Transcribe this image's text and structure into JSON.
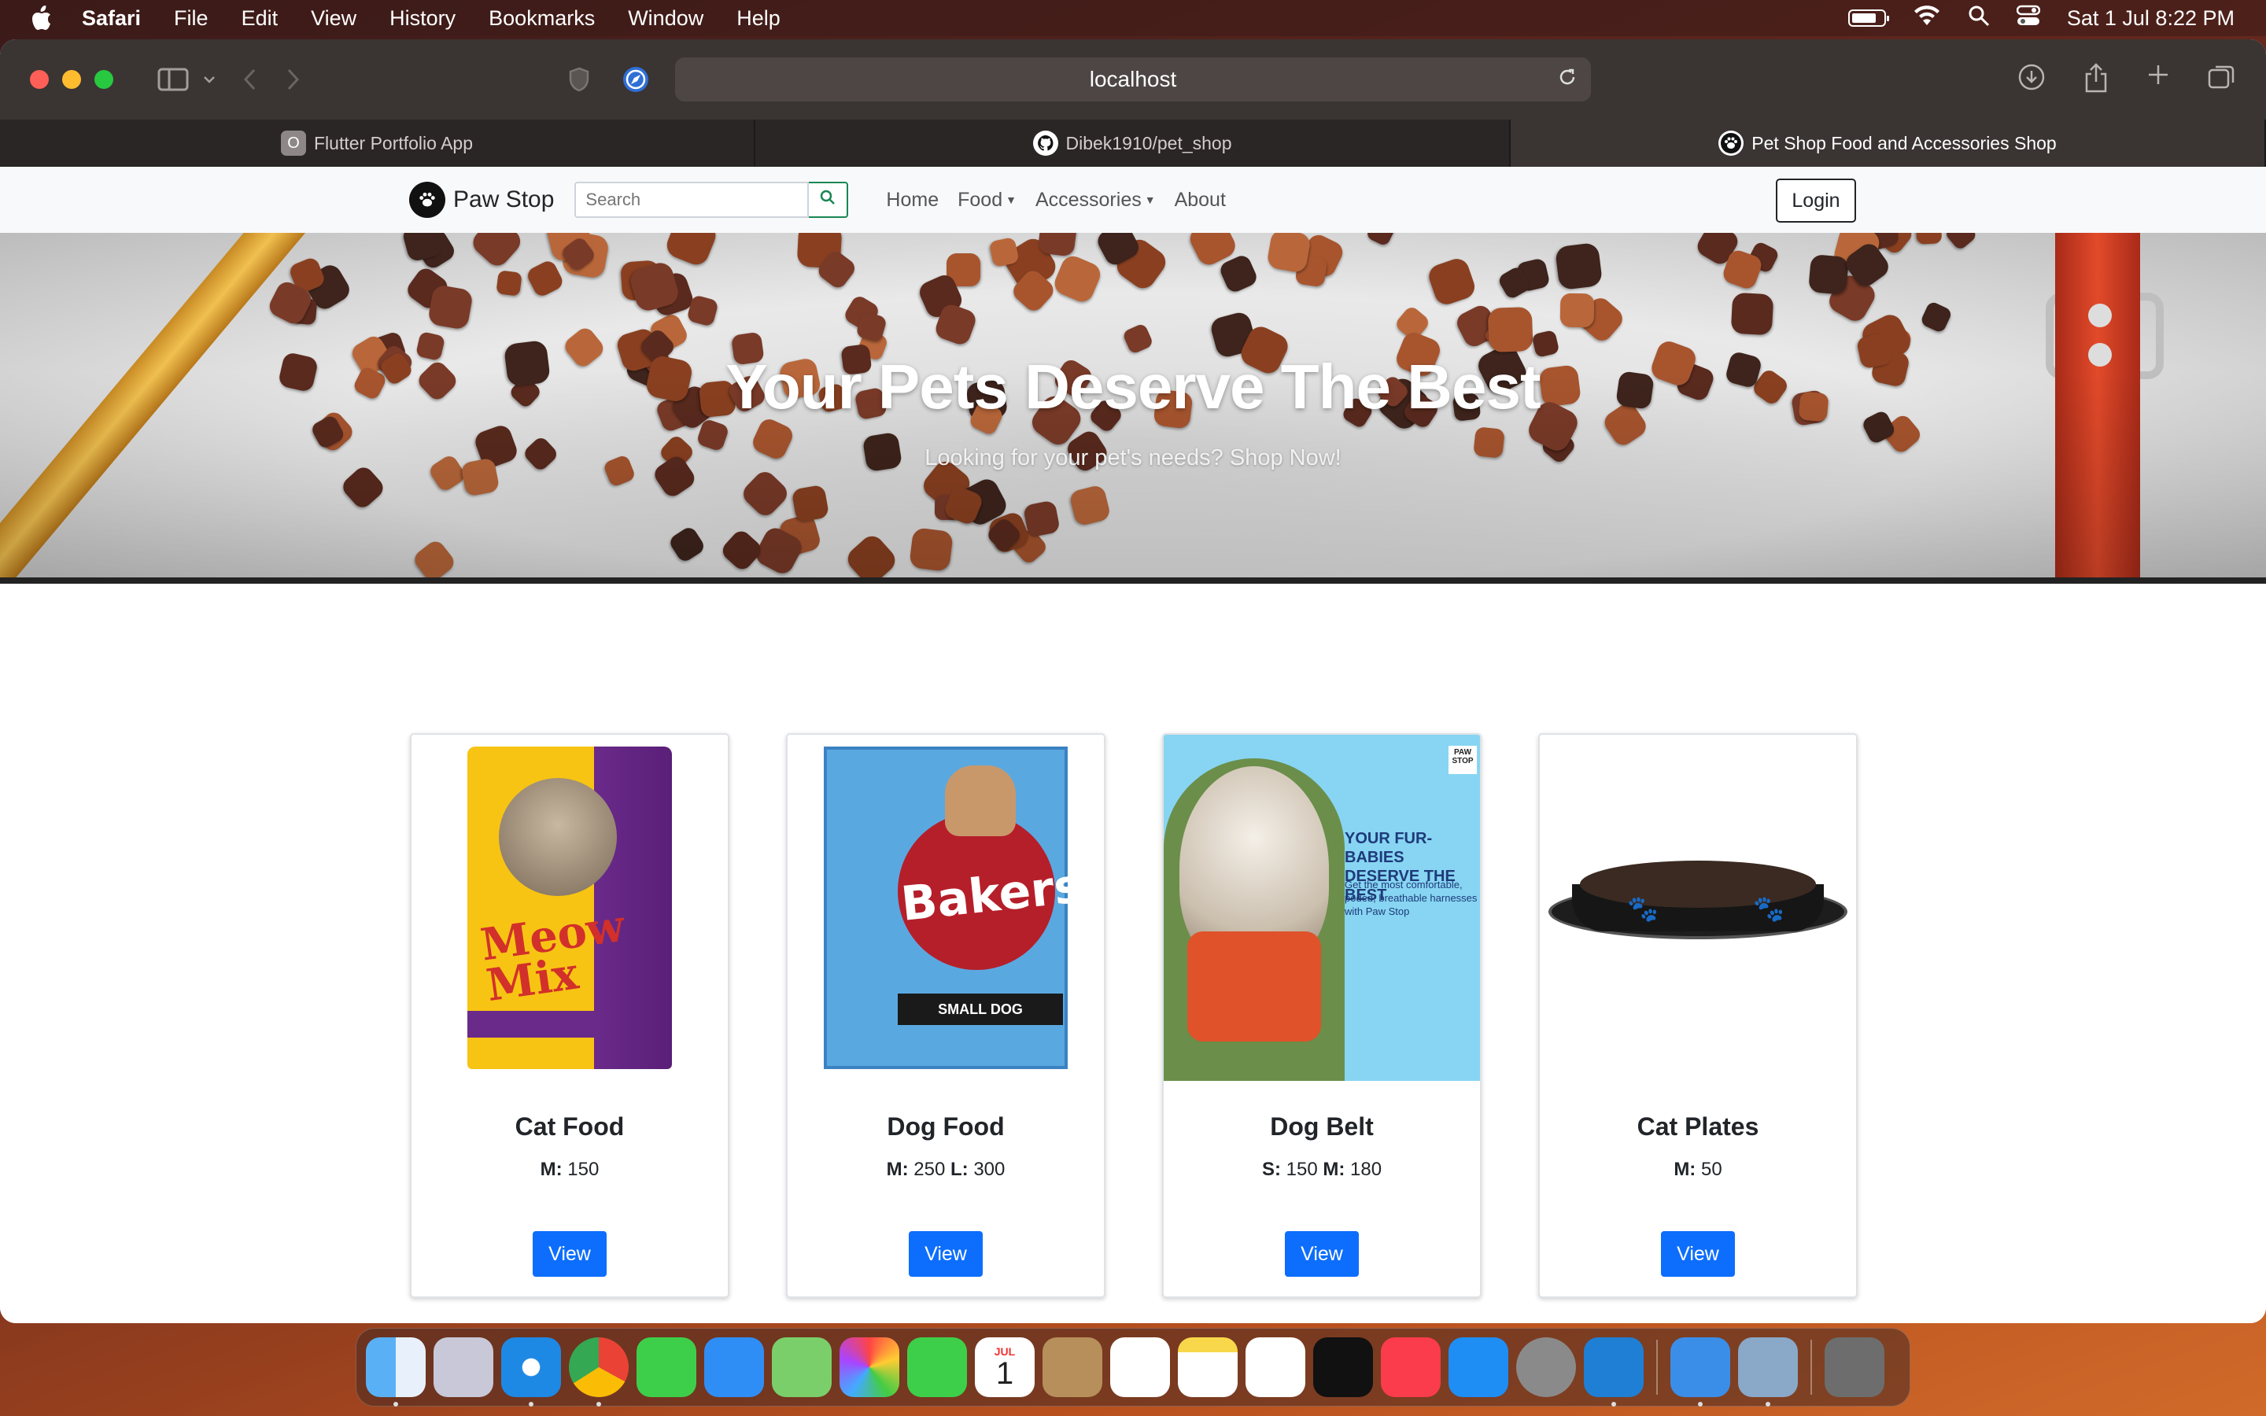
{
  "menubar": {
    "app_name": "Safari",
    "items": [
      "File",
      "Edit",
      "View",
      "History",
      "Bookmarks",
      "Window",
      "Help"
    ],
    "datetime": "Sat 1 Jul  8:22 PM"
  },
  "browser": {
    "url": "localhost",
    "tabs": [
      {
        "label": "Flutter Portfolio App",
        "icon": "flutter-icon",
        "active": false
      },
      {
        "label": "Dibek1910/pet_shop",
        "icon": "github-icon",
        "active": false
      },
      {
        "label": "Pet Shop Food and Accessories Shop",
        "icon": "paw-icon",
        "active": true
      }
    ]
  },
  "nav": {
    "brand": "Paw Stop",
    "search_placeholder": "Search",
    "links": [
      {
        "label": "Home",
        "dropdown": false
      },
      {
        "label": "Food",
        "dropdown": true
      },
      {
        "label": "Accessories",
        "dropdown": true
      },
      {
        "label": "About",
        "dropdown": false
      }
    ],
    "login_label": "Login"
  },
  "hero": {
    "title": "Your Pets Deserve The Best",
    "subtitle": "Looking for your pet's needs? Shop Now!"
  },
  "products": [
    {
      "name": "Cat Food",
      "prices": [
        {
          "size": "M:",
          "value": "150"
        }
      ],
      "button": "View"
    },
    {
      "name": "Dog Food",
      "prices": [
        {
          "size": "M:",
          "value": "250"
        },
        {
          "size": "L:",
          "value": "300"
        }
      ],
      "button": "View"
    },
    {
      "name": "Dog Belt",
      "prices": [
        {
          "size": "S:",
          "value": "150"
        },
        {
          "size": "M:",
          "value": "180"
        }
      ],
      "button": "View"
    },
    {
      "name": "Cat Plates",
      "prices": [
        {
          "size": "M:",
          "value": "50"
        }
      ],
      "button": "View"
    }
  ],
  "product_art": {
    "cat_food_brand": "Meow Mix",
    "dog_food_brand": "Bakers",
    "dog_food_label": "SMALL DOG",
    "dog_belt_headline": "YOUR FUR-BABIES DESERVE THE BEST",
    "dog_belt_copy": "Get the most comfortable, poded, breathable harnesses with Paw Stop",
    "dog_belt_tag": "PAW STOP"
  },
  "dock": {
    "calendar_month": "JUL",
    "calendar_day": "1"
  },
  "colors": {
    "primary_button": "#0d6efd",
    "search_button": "#198754"
  }
}
